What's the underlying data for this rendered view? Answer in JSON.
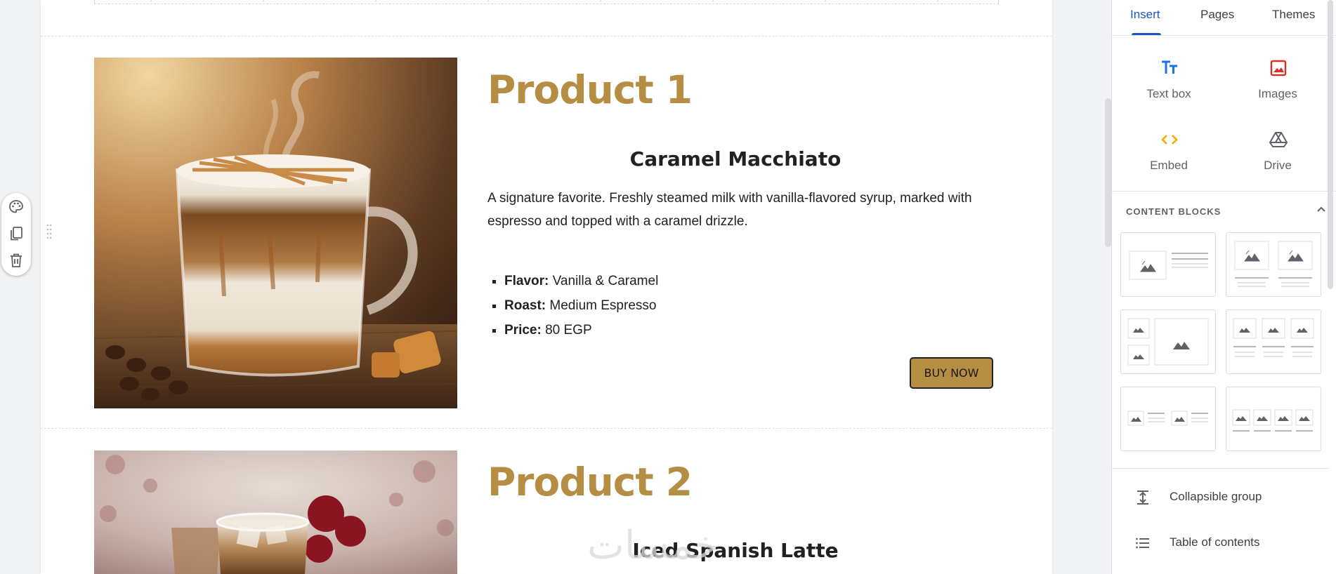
{
  "canvas": {
    "watermark_text": "خمسات",
    "products": [
      {
        "title": "Product 1",
        "name": "Caramel Macchiato",
        "description": "A signature favorite. Freshly steamed milk with vanilla-flavored syrup, marked with espresso and topped with a caramel drizzle.",
        "specs": [
          {
            "label": "Flavor:",
            "value": " Vanilla & Caramel"
          },
          {
            "label": "Roast:",
            "value": " Medium Espresso"
          },
          {
            "label": "Price:",
            "value": " 80 EGP"
          }
        ],
        "button_label": "BUY NOW"
      },
      {
        "title": "Product 2",
        "name": "Iced Spanish Latte"
      }
    ]
  },
  "toolbar_icons": [
    "palette-icon",
    "duplicate-icon",
    "delete-icon"
  ],
  "panel": {
    "tabs": [
      "Insert",
      "Pages",
      "Themes"
    ],
    "active_tab": "Insert",
    "insert_items": [
      {
        "label": "Text box",
        "icon": "text-box-icon",
        "color": "#1a73e8"
      },
      {
        "label": "Images",
        "icon": "image-icon",
        "color": "#d93025"
      },
      {
        "label": "Embed",
        "icon": "embed-icon",
        "color": "#f9ab00"
      },
      {
        "label": "Drive",
        "icon": "drive-icon",
        "color": "#5f6368"
      }
    ],
    "content_blocks_title": "CONTENT BLOCKS",
    "list_items": [
      {
        "label": "Collapsible group",
        "icon": "collapsible-group-icon"
      },
      {
        "label": "Table of contents",
        "icon": "table-of-contents-icon"
      }
    ]
  },
  "colors": {
    "accent_gold": "#b58d43",
    "tab_active": "#1a56c8",
    "text_dark": "#202124",
    "canvas_bg": "#f1f3f4"
  }
}
